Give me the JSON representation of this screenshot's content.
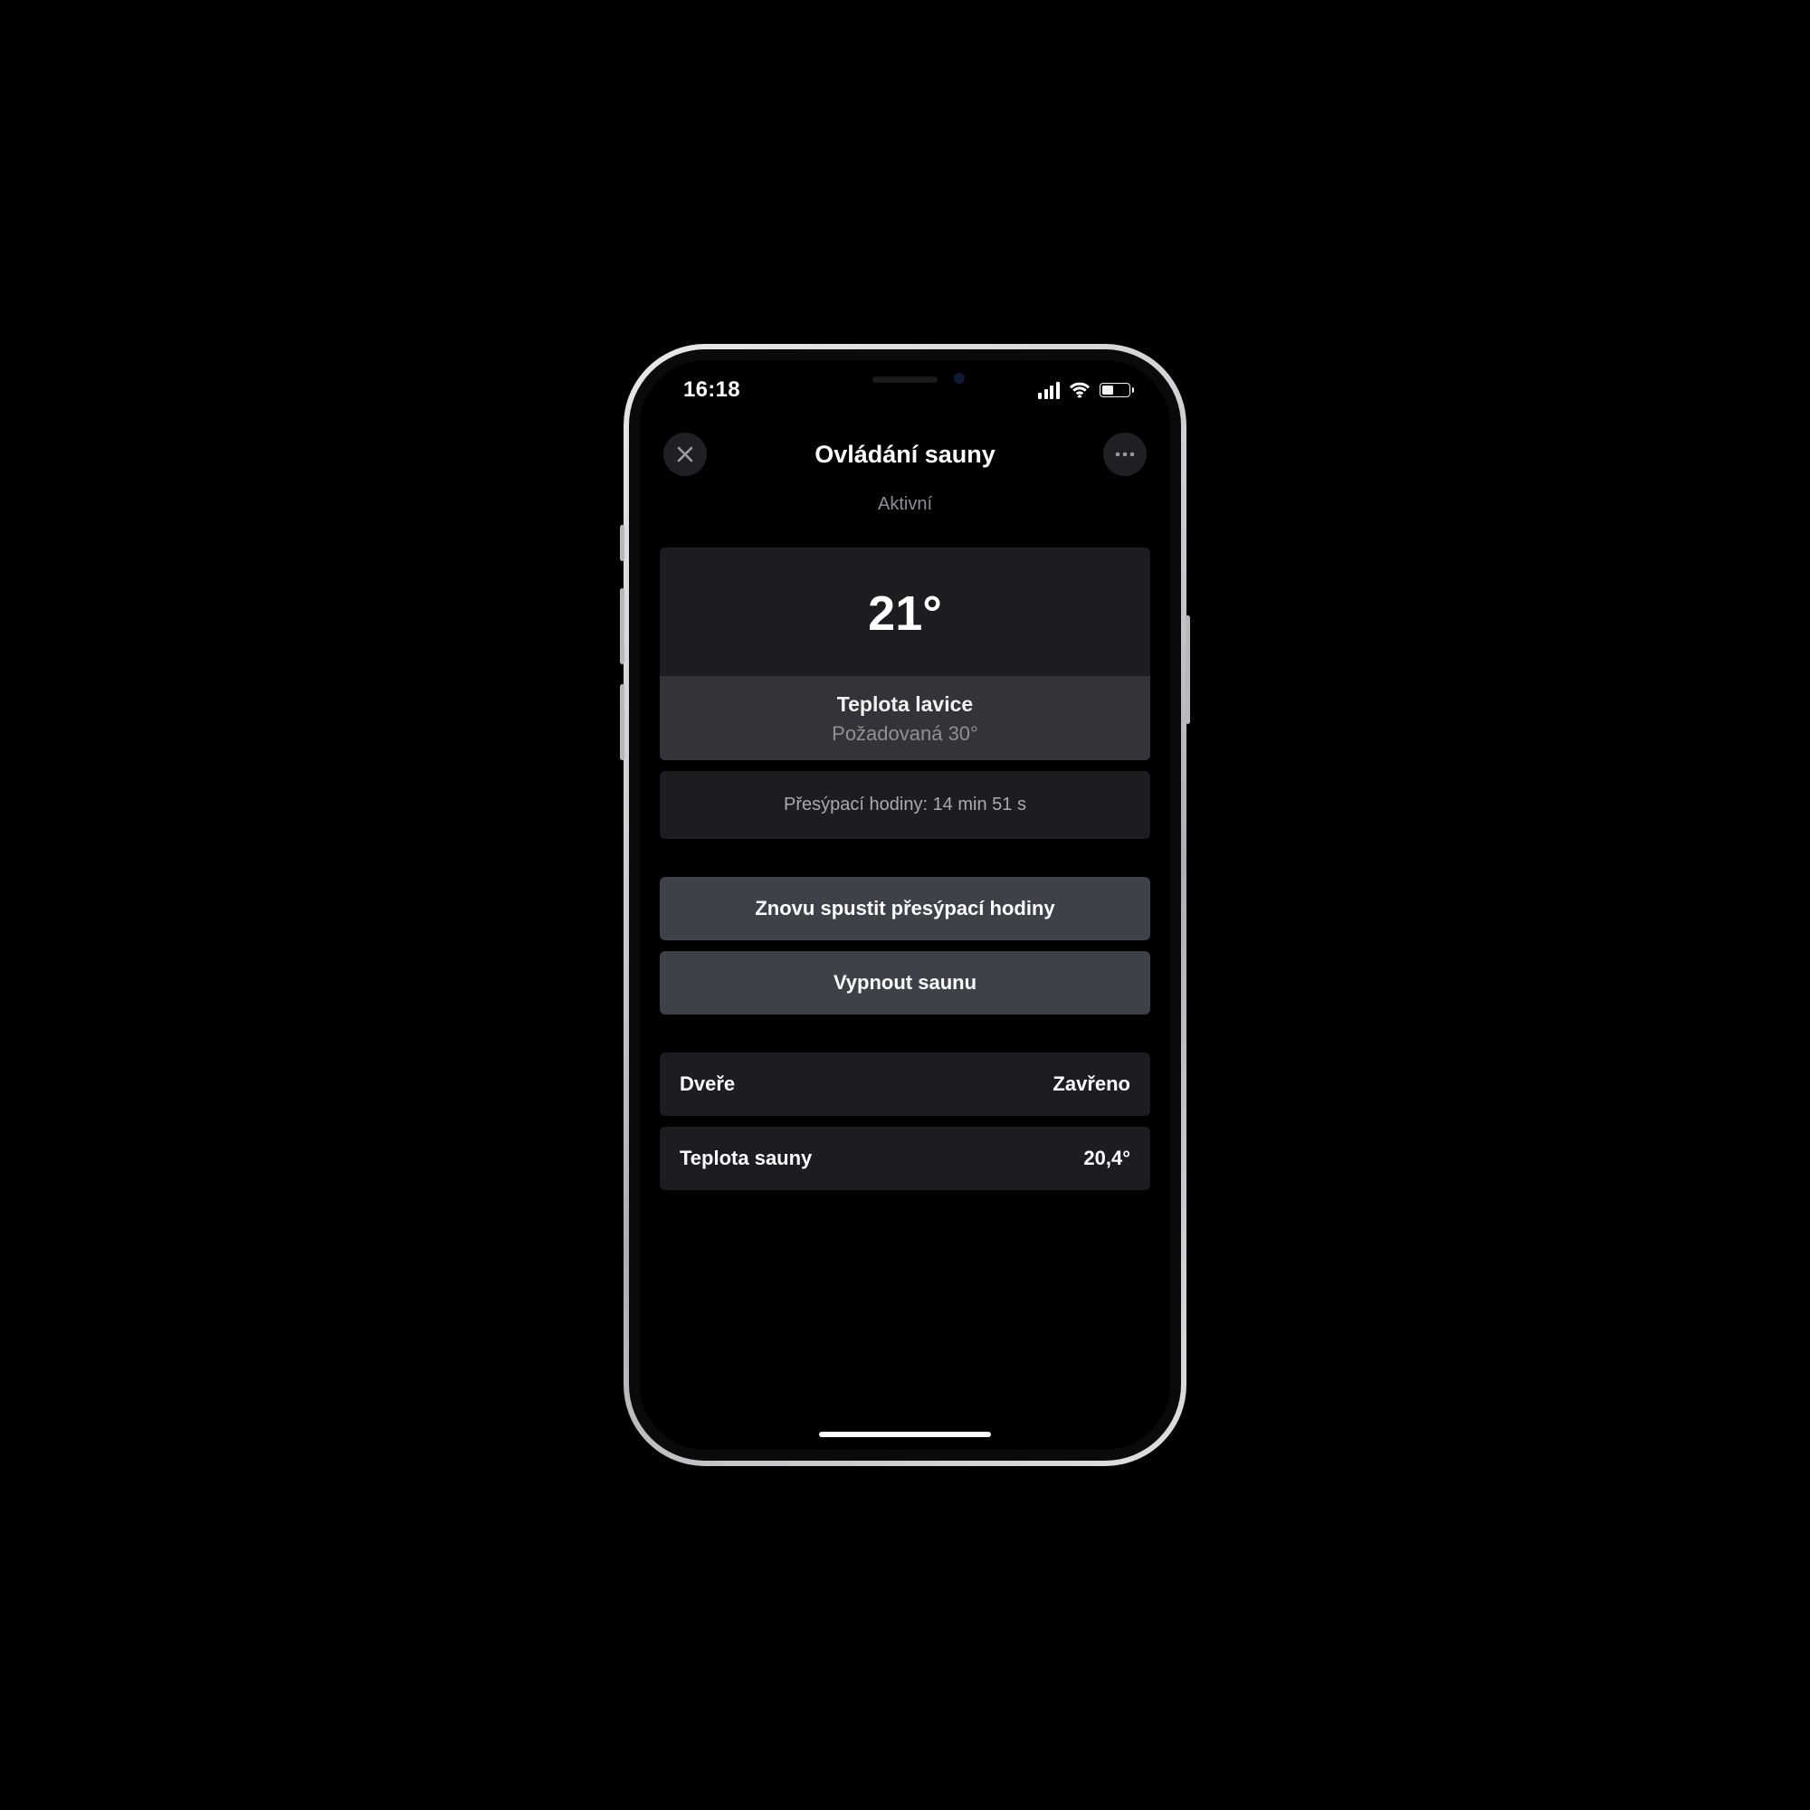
{
  "status": {
    "time": "16:18"
  },
  "header": {
    "title": "Ovládání sauny",
    "subtitle": "Aktivní"
  },
  "temperature": {
    "current": "21°",
    "bench_label": "Teplota lavice",
    "target": "Požadovaná 30°"
  },
  "hourglass": {
    "label": "Přesýpací hodiny: 14 min 51 s"
  },
  "actions": {
    "restart_hourglass": "Znovu spustit přesýpací hodiny",
    "turn_off": "Vypnout saunu"
  },
  "status_rows": {
    "door_label": "Dveře",
    "door_value": "Zavřeno",
    "sauna_temp_label": "Teplota sauny",
    "sauna_temp_value": "20,4°"
  }
}
